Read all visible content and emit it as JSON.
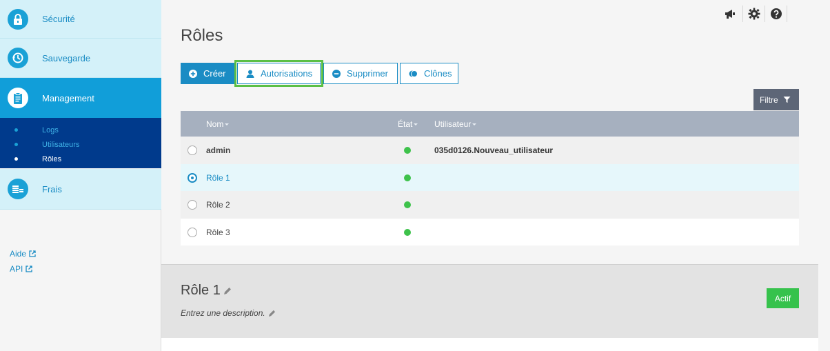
{
  "sidebar": {
    "nav": {
      "securite": "Sécurité",
      "sauvegarde": "Sauvegarde",
      "management": "Management",
      "frais": "Frais"
    },
    "sub": {
      "logs": "Logs",
      "utilisateurs": "Utilisateurs",
      "roles": "Rôles"
    },
    "links": {
      "aide": "Aide",
      "api": "API"
    }
  },
  "header": {
    "icons": [
      "megaphone-icon",
      "gear-icon",
      "help-icon"
    ]
  },
  "page": {
    "title": "Rôles"
  },
  "toolbar": {
    "create": "Créer",
    "permissions": "Autorisations",
    "delete": "Supprimer",
    "clones": "Clônes",
    "filter": "Filtre"
  },
  "table": {
    "columns": {
      "name": "Nom",
      "state": "État",
      "user": "Utilisateur"
    },
    "rows": [
      {
        "name": "admin",
        "state": "active",
        "user": "035d0126.Nouveau_utilisateur",
        "selected": false
      },
      {
        "name": "Rôle 1",
        "state": "active",
        "user": "",
        "selected": true
      },
      {
        "name": "Rôle 2",
        "state": "active",
        "user": "",
        "selected": false
      },
      {
        "name": "Rôle 3",
        "state": "active",
        "user": "",
        "selected": false
      }
    ]
  },
  "detail": {
    "title": "Rôle 1",
    "description": "Entrez une description.",
    "status_button": "Actif"
  },
  "colors": {
    "accent": "#1a8cc4",
    "nav_bg": "#d4f1f9",
    "nav_active": "#119ed9",
    "subnav_bg": "#003a8c",
    "header_row": "#a6b0bf",
    "status_green": "#3ec24b",
    "highlight": "#5bbf45"
  }
}
